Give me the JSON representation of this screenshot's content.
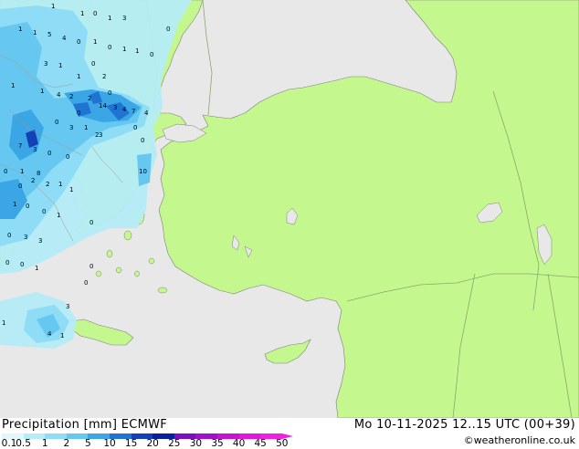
{
  "map": {
    "land_color": "#c4f88f",
    "sea_color": "#e8e8e8",
    "border_color": "#8aa86a",
    "coast_color": "#7e7e7e",
    "precip_colors": [
      "#b4ecf7",
      "#8edcf5",
      "#66c8f0",
      "#3aa6e6",
      "#1f74d2",
      "#1440b8"
    ],
    "cell_values": [
      "1",
      "1",
      "0",
      "1",
      "3",
      "1",
      "1",
      "5",
      "4",
      "0",
      "1",
      "0",
      "1",
      "1",
      "0",
      "3",
      "1",
      "0",
      "1",
      "2",
      "1",
      "1",
      "4",
      "2",
      "2",
      "14",
      "3",
      "4",
      "7",
      "4",
      "0",
      "3",
      "1",
      "0",
      "7",
      "3",
      "0",
      "0",
      "2",
      "3",
      "0",
      "0",
      "1",
      "8",
      "10",
      "0",
      "2",
      "2",
      "1",
      "1",
      "1",
      "0",
      "0",
      "1",
      "0",
      "3",
      "3",
      "0",
      "1",
      "3",
      "4",
      "1",
      "0",
      "0",
      "0",
      "0",
      "0",
      "0",
      "1",
      "0"
    ]
  },
  "legend": {
    "title": "Precipitation [mm]  ECMWF",
    "datetime": "Mo 10-11-2025 12..15 UTC (00+39)",
    "credit": "©weatheronline.co.uk",
    "ticks": [
      "0.1",
      "0.5",
      "1",
      "2",
      "5",
      "10",
      "15",
      "20",
      "25",
      "30",
      "35",
      "40",
      "45",
      "50"
    ],
    "colors": [
      "#e0f8fc",
      "#b4ecf7",
      "#8edcf5",
      "#66c8f0",
      "#3aa6e6",
      "#1f74d2",
      "#1440b8",
      "#0a1fa0",
      "#7a10c0",
      "#a012c8",
      "#c414d0",
      "#e018d8",
      "#f020e0"
    ]
  }
}
